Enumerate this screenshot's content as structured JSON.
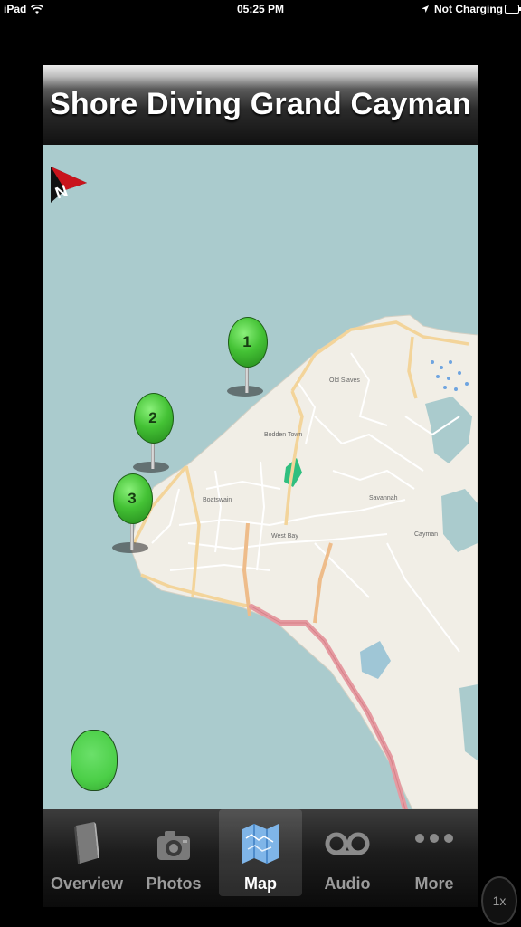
{
  "status_bar": {
    "device": "iPad",
    "time": "05:25 PM",
    "battery_status": "Not Charging"
  },
  "header": {
    "title": "Shore Diving Grand Cayman"
  },
  "map": {
    "labels": [
      "Old Slaves",
      "Bodden Town",
      "Boatswain",
      "Savannah",
      "West Bay",
      "Cayman"
    ],
    "pins": [
      {
        "number": "1",
        "color": "#44c235"
      },
      {
        "number": "2",
        "color": "#44c235"
      },
      {
        "number": "3",
        "color": "#44c235"
      }
    ],
    "colors": {
      "water": "#aacbcd",
      "land": "#f1eee6",
      "road_main": "#e59aa1",
      "road_secondary": "#f3d49a"
    }
  },
  "tabs": [
    {
      "label": "Overview",
      "icon": "book-icon"
    },
    {
      "label": "Photos",
      "icon": "camera-icon"
    },
    {
      "label": "Map",
      "icon": "map-icon",
      "active": true
    },
    {
      "label": "Audio",
      "icon": "voicemail-icon"
    },
    {
      "label": "More",
      "icon": "more-dots-icon"
    }
  ],
  "zoom_badge": "1x"
}
